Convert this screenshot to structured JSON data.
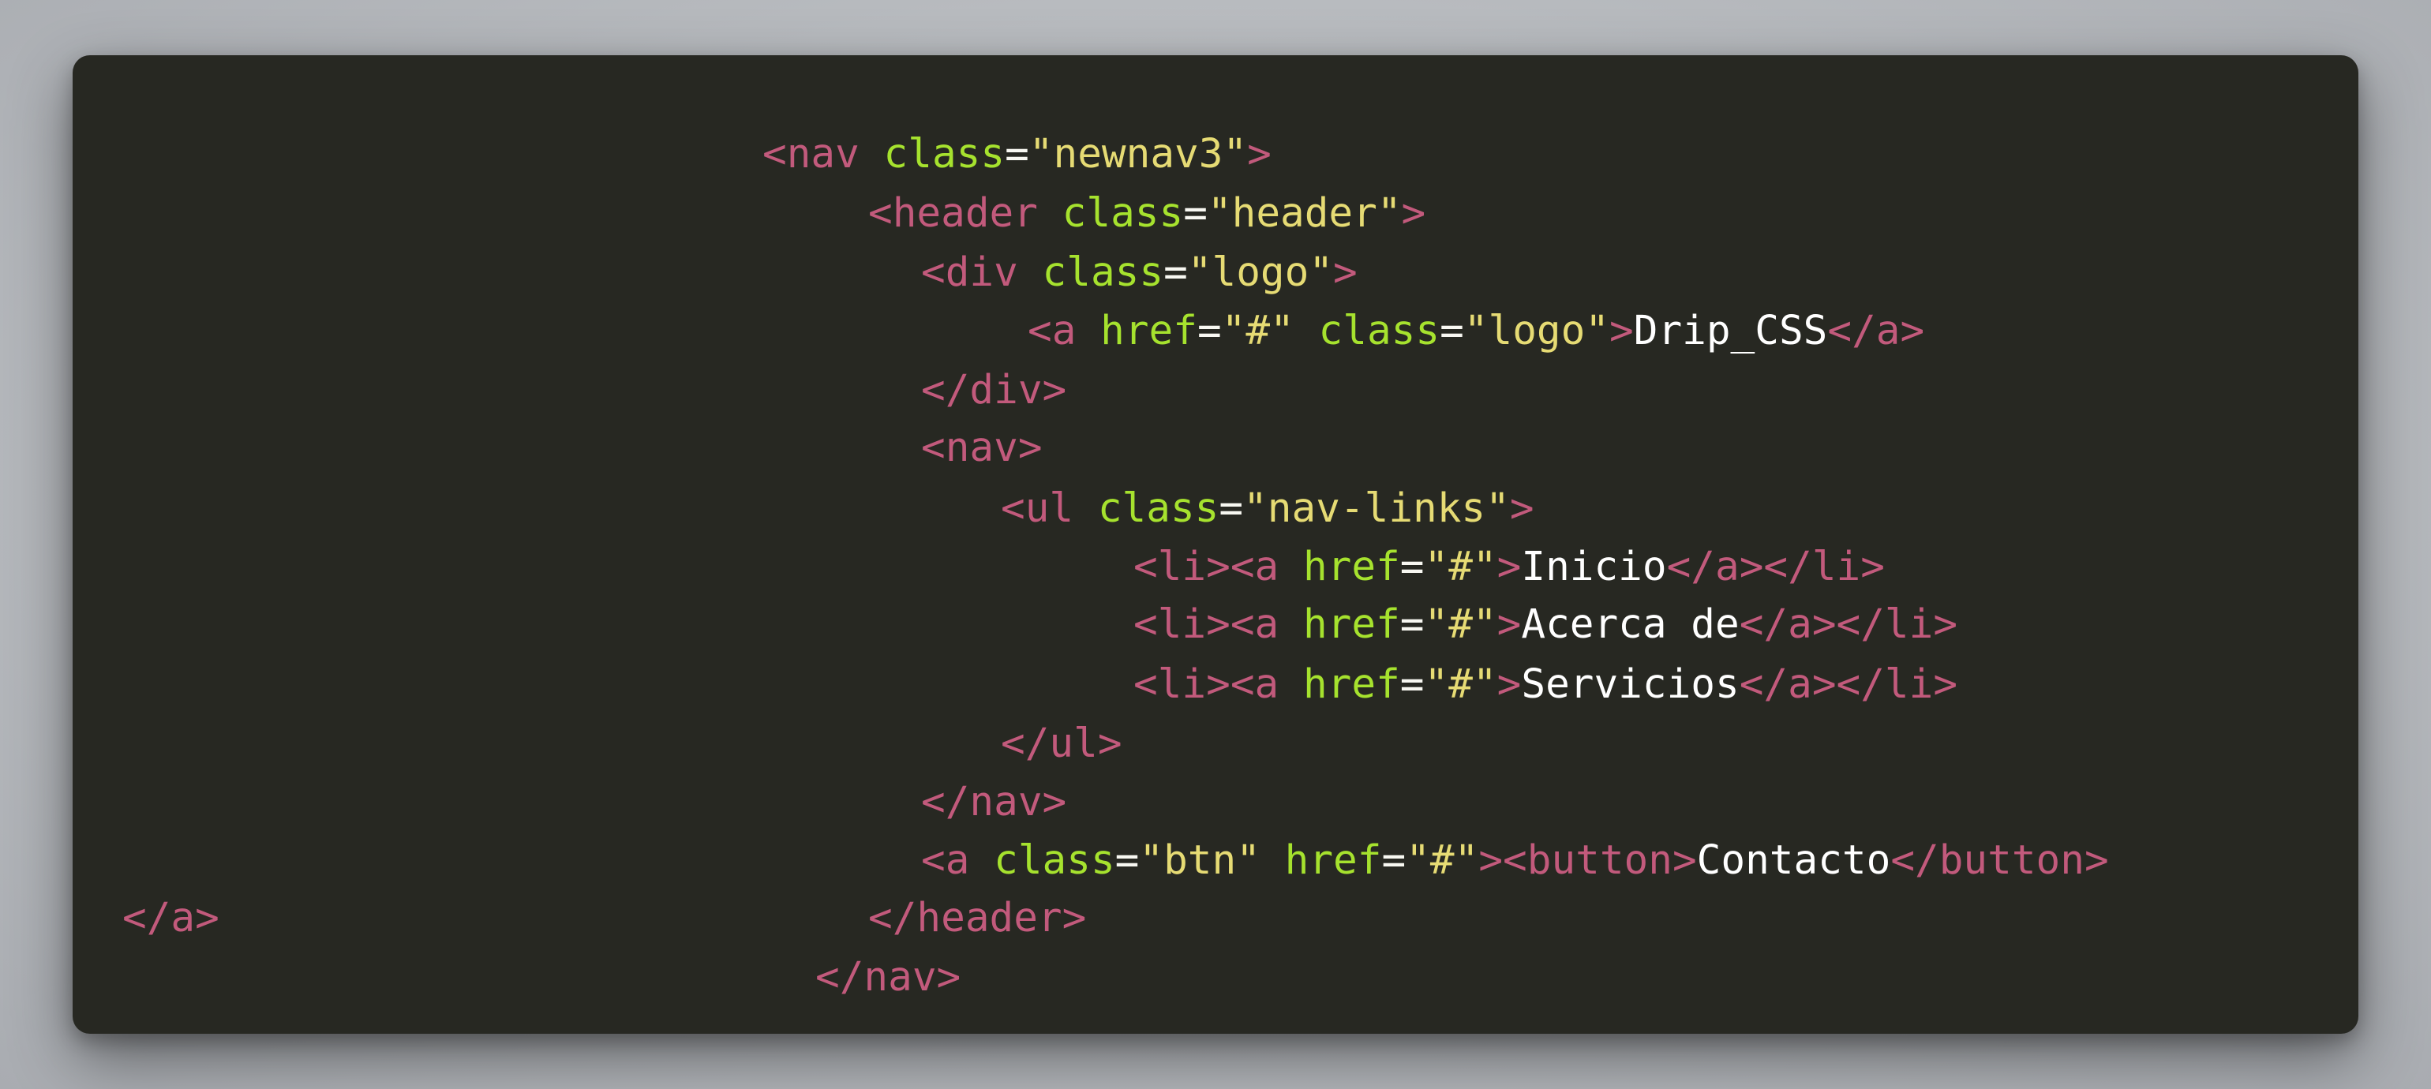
{
  "colors": {
    "background": "#272822",
    "tag": "#c25a7c",
    "attribute": "#a6e22e",
    "string": "#e6db74",
    "text": "#ffffff",
    "page_backdrop": "#b9bcc0"
  },
  "code": {
    "language": "html",
    "lines": [
      {
        "tag_open": "<nav",
        "attr1": "class",
        "eq1": "=",
        "val1": "\"newnav3\"",
        "tag_close": ">"
      },
      {
        "tag_open": "<header",
        "attr1": "class",
        "eq1": "=",
        "val1": "\"header\"",
        "tag_close": ">"
      },
      {
        "tag_open": "<div",
        "attr1": "class",
        "eq1": "=",
        "val1": "\"logo\"",
        "tag_close": ">"
      },
      {
        "tag_open": "<a",
        "attr1": "href",
        "eq1": "=",
        "val1": "\"#\"",
        "attr2": "class",
        "eq2": "=",
        "val2": "\"logo\"",
        "tag_close": ">",
        "text": "Drip_CSS",
        "end_tag": "</a>"
      },
      {
        "end_tag": "</div>"
      },
      {
        "tag_open": "<nav>"
      },
      {
        "tag_open": "<ul",
        "attr1": "class",
        "eq1": "=",
        "val1": "\"nav-links\"",
        "tag_close": ">"
      },
      {
        "li_open": "<li>",
        "tag_open": "<a",
        "attr1": "href",
        "eq1": "=",
        "val1": "\"#\"",
        "tag_close": ">",
        "text": "Inicio",
        "end_tag": "</a></li>"
      },
      {
        "li_open": "<li>",
        "tag_open": "<a",
        "attr1": "href",
        "eq1": "=",
        "val1": "\"#\"",
        "tag_close": ">",
        "text": "Acerca de",
        "end_tag": "</a></li>"
      },
      {
        "li_open": "<li>",
        "tag_open": "<a",
        "attr1": "href",
        "eq1": "=",
        "val1": "\"#\"",
        "tag_close": ">",
        "text": "Servicios",
        "end_tag": "</a></li>"
      },
      {
        "end_tag": "</ul>"
      },
      {
        "end_tag": "</nav>"
      },
      {
        "tag_open": "<a",
        "attr1": "class",
        "eq1": "=",
        "val1": "\"btn\"",
        "attr2": "href",
        "eq2": "=",
        "val2": "\"#\"",
        "tag_close": ">",
        "button_open": "<button>",
        "text": "Contacto",
        "end_tag": "</button>"
      },
      {
        "stray": "</a>",
        "end_tag": "</header>"
      },
      {
        "end_tag": "</nav>"
      }
    ]
  }
}
